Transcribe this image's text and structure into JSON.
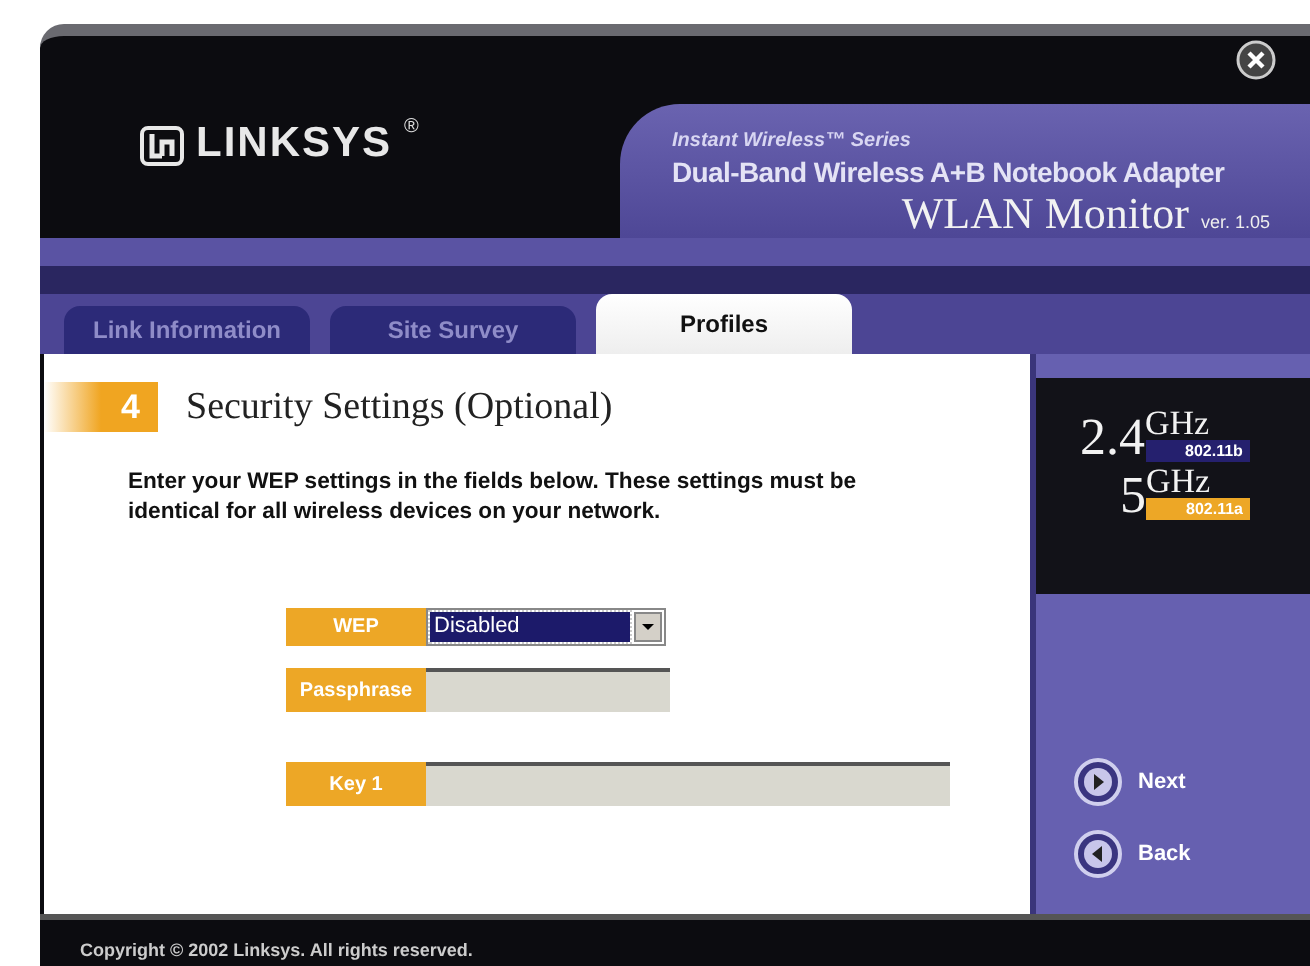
{
  "window": {
    "brand": "LINKSYS",
    "brand_mark": "®"
  },
  "product": {
    "series": "Instant Wireless™ Series",
    "name": "Dual-Band Wireless A+B Notebook Adapter",
    "app": "WLAN Monitor",
    "version": "ver. 1.05"
  },
  "tabs": [
    {
      "label": "Link Information",
      "selected": false
    },
    {
      "label": "Site Survey",
      "selected": false
    },
    {
      "label": "Profiles",
      "selected": true
    }
  ],
  "step": {
    "number": "4",
    "title": "Security Settings (Optional)"
  },
  "instructions": "Enter your  WEP settings in the fields below. These settings must be identical for all wireless devices on your network.",
  "fields": [
    {
      "kind": "select",
      "label": "WEP",
      "value": "Disabled"
    },
    {
      "kind": "text",
      "label": "Passphrase"
    },
    {
      "kind": "key",
      "label": "Key 1"
    }
  ],
  "bands": [
    {
      "freq": "2.4",
      "unit": "GHz",
      "standard": "802.11b",
      "color": "#25206e"
    },
    {
      "freq": "5",
      "unit": "GHz",
      "standard": "802.11a",
      "color": "#eda726"
    }
  ],
  "nav": [
    {
      "kind": "next",
      "label": "Next"
    },
    {
      "kind": "back",
      "label": "Back"
    }
  ],
  "status_bar": "Copyright © 2002 Linksys.  All rights reserved."
}
